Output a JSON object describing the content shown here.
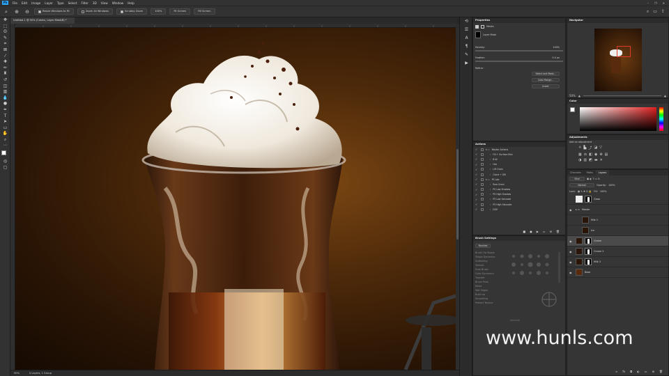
{
  "menu": {
    "items": [
      "File",
      "Edit",
      "Image",
      "Layer",
      "Type",
      "Select",
      "Filter",
      "3D",
      "View",
      "Window",
      "Help"
    ],
    "app_logo": "Ps"
  },
  "options": {
    "resize_windows": "Resize Windows to Fit",
    "zoom_all": "Zoom All Windows",
    "scrubby_zoom": "Scrubby Zoom",
    "zoom_100": "100%",
    "fit_screen": "Fit Screen",
    "fill_screen": "Fill Screen"
  },
  "document": {
    "tab_title": "Untitled-1 @ 50% (Cream, Layer Mask/8) *",
    "zoom": "50%",
    "status": "0 Layers, 1 Group"
  },
  "properties": {
    "title": "Properties",
    "masks_label": "Masks",
    "layer_mask_label": "Layer Mask",
    "density_label": "Density:",
    "density_value": "100%",
    "feather_label": "Feather:",
    "feather_value": "0.0 px",
    "refine_label": "Refine:",
    "select_mask_btn": "Select and Mask...",
    "color_range_btn": "Color Range...",
    "invert_btn": "Invert"
  },
  "actions": {
    "title": "Actions",
    "items": [
      "Master Actions",
      "Fill + Surface Blur",
      "B-W",
      "Hat",
      "Lift Grain",
      "Clone + DB",
      "PS Lab",
      "Raw Grain",
      "PS Low Shadow",
      "PS High Shadow",
      "PS Low Saturate",
      "PS High Saturate",
      "DOE"
    ]
  },
  "brush": {
    "title": "Brush Settings",
    "brushes_btn": "Brushes",
    "options": [
      "Brush Tip Shape",
      "Shape Dynamics",
      "Scattering",
      "Texture",
      "Dual Brush",
      "Color Dynamics",
      "Transfer",
      "Brush Pose",
      "Noise",
      "Wet Edges",
      "Build-up",
      "Smoothing",
      "Protect Texture"
    ],
    "spacing_label": "Spacing"
  },
  "navigator": {
    "title": "Navigator",
    "zoom": "50%"
  },
  "color": {
    "title": "Color",
    "accent": "#e02020"
  },
  "adjustments": {
    "title": "Adjustments",
    "subtitle": "Add an adjustment"
  },
  "layers": {
    "tabs": [
      "Channels",
      "Paths",
      "Layers"
    ],
    "kind_label": "Kind",
    "blend_mode": "Normal",
    "opacity_label": "Opacity:",
    "opacity_value": "100%",
    "lock_label": "Lock:",
    "fill_label": "Fill:",
    "fill_value": "100%",
    "items": [
      {
        "name": "Glass",
        "type": "group"
      },
      {
        "name": "Master",
        "type": "group"
      },
      {
        "name": "Milk 1",
        "type": "layer"
      },
      {
        "name": "Ice",
        "type": "layer"
      },
      {
        "name": "Cream",
        "type": "masked",
        "selected": true
      },
      {
        "name": "Cream 2",
        "type": "masked"
      },
      {
        "name": "Milk 3",
        "type": "masked"
      },
      {
        "name": "Base",
        "type": "layer"
      }
    ]
  },
  "watermark": "www.hunls.com"
}
